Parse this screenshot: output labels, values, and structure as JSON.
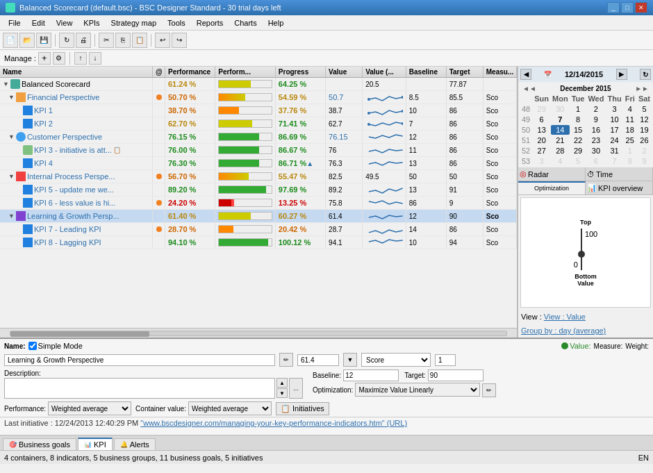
{
  "titleBar": {
    "title": "Balanced Scorecard (default.bsc) - BSC Designer Standard - 30 trial days left",
    "icon": "bsc-icon"
  },
  "menuBar": {
    "items": [
      "File",
      "Edit",
      "View",
      "KPIs",
      "Strategy map",
      "Tools",
      "Reports",
      "Charts",
      "Help"
    ]
  },
  "manageBar": {
    "label": "Manage :"
  },
  "tableHeaders": {
    "name": "Name",
    "at": "@",
    "performance": "Performance",
    "performBar": "Perform...",
    "progress": "Progress",
    "value": "Value",
    "value2": "Value (...",
    "baseline": "Baseline",
    "target": "Target",
    "measure": "Measu..."
  },
  "tableRows": [
    {
      "indent": 0,
      "type": "root",
      "name": "Balanced Scorecard",
      "perf": "",
      "prog": "64.25 %",
      "value": "",
      "value2": "20.5",
      "baseline": "",
      "target": "77.87",
      "measure": "",
      "expanded": true,
      "perfVal": "61.24 %",
      "perfColor": "yellow"
    },
    {
      "indent": 1,
      "type": "perspective",
      "name": "Financial Perspective",
      "perf": "50.70 %",
      "perfColor": "orange",
      "prog": "54.59 %",
      "value": "50.7",
      "value2": "",
      "baseline": "8.5",
      "target": "85.5",
      "measure": "Sco",
      "expanded": true
    },
    {
      "indent": 2,
      "type": "kpi",
      "name": "KPI 1",
      "perf": "38.70 %",
      "perfColor": "orange",
      "prog": "37.76 %",
      "value": "38.7",
      "value2": "",
      "baseline": "10",
      "target": "86",
      "measure": "Sco"
    },
    {
      "indent": 2,
      "type": "kpi",
      "name": "KPI 2",
      "perf": "62.70 %",
      "perfColor": "yellow",
      "prog": "71.41 %",
      "value": "62.7",
      "value2": "",
      "baseline": "7",
      "target": "86",
      "measure": "Sco"
    },
    {
      "indent": 1,
      "type": "perspective",
      "name": "Customer Perspective",
      "perf": "76.15 %",
      "perfColor": "green",
      "prog": "86.69 %",
      "value": "76.15",
      "value2": "",
      "baseline": "12",
      "target": "86",
      "measure": "Sco",
      "expanded": true
    },
    {
      "indent": 2,
      "type": "initiative",
      "name": "KPI 3 - initiative is att...",
      "perf": "76.00 %",
      "perfColor": "green",
      "prog": "86.67 %",
      "value": "76",
      "value2": "",
      "baseline": "11",
      "target": "86",
      "measure": "Sco"
    },
    {
      "indent": 2,
      "type": "kpi",
      "name": "KPI 4",
      "perf": "76.30 %",
      "perfColor": "green",
      "prog": "86.71 %",
      "value": "76.3",
      "value2": "",
      "baseline": "13",
      "target": "86",
      "measure": "Sco"
    },
    {
      "indent": 1,
      "type": "perspective",
      "name": "Internal Process Perspe...",
      "perf": "56.70 %",
      "perfColor": "orange",
      "prog": "55.47 %",
      "value": "82.5",
      "value2": "49.5",
      "baseline": "50",
      "target": "50",
      "measure": "Sco",
      "expanded": true
    },
    {
      "indent": 2,
      "type": "kpi",
      "name": "KPI 5 - update me we...",
      "perf": "89.20 %",
      "perfColor": "green",
      "prog": "97.69 %",
      "value": "89.2",
      "value2": "",
      "baseline": "13",
      "target": "91",
      "measure": "Sco"
    },
    {
      "indent": 2,
      "type": "kpi",
      "name": "KPI 6 - less value is hi...",
      "perf": "24.20 %",
      "perfColor": "red",
      "prog": "13.25 %",
      "value": "75.8",
      "value2": "",
      "baseline": "86",
      "target": "9",
      "measure": "Sco"
    },
    {
      "indent": 1,
      "type": "perspective",
      "name": "Learning & Growth Persp...",
      "perf": "61.40 %",
      "perfColor": "yellow",
      "prog": "60.27 %",
      "value": "61.4",
      "value2": "",
      "baseline": "12",
      "target": "90",
      "measure": "Sco",
      "selected": true,
      "expanded": true
    },
    {
      "indent": 2,
      "type": "kpi",
      "name": "KPI 7 - Leading KPI",
      "perf": "28.70 %",
      "perfColor": "orange",
      "prog": "20.42 %",
      "value": "28.7",
      "value2": "",
      "baseline": "14",
      "target": "86",
      "measure": "Sco"
    },
    {
      "indent": 2,
      "type": "kpi",
      "name": "KPI 8 - Lagging KPI",
      "perf": "94.10 %",
      "perfColor": "green",
      "prog": "100.12 %",
      "value": "94.1",
      "value2": "",
      "baseline": "10",
      "target": "94",
      "measure": "Sco"
    }
  ],
  "rightPanel": {
    "dateHeader": "12/14/2015",
    "calMonth": "December 2015",
    "calDays": [
      "Sun",
      "Mon",
      "Tue",
      "Wed",
      "Thu",
      "Fri",
      "Sat"
    ],
    "calWeeks": [
      {
        "week": 48,
        "days": [
          "29",
          "30",
          "1",
          "2",
          "3",
          "4",
          "5"
        ]
      },
      {
        "week": 49,
        "days": [
          "6",
          "7",
          "8",
          "9",
          "10",
          "11",
          "12"
        ]
      },
      {
        "week": 50,
        "days": [
          "13",
          "14",
          "15",
          "16",
          "17",
          "18",
          "19"
        ]
      },
      {
        "week": 51,
        "days": [
          "20",
          "21",
          "22",
          "23",
          "24",
          "25",
          "26"
        ]
      },
      {
        "week": 52,
        "days": [
          "27",
          "28",
          "29",
          "30",
          "31",
          "1",
          "2"
        ]
      },
      {
        "week": 53,
        "days": [
          "3",
          "4",
          "5",
          "6",
          "7",
          "8",
          "9"
        ]
      }
    ],
    "tabs": [
      "Radar",
      "Time",
      "Optimization",
      "KPI overview"
    ],
    "topLabel": "Top",
    "bottomLabel": "Bottom",
    "valueLabel": "Value",
    "viewLabel": "View : Value",
    "groupByLabel": "Group by : day (average)"
  },
  "bottomPanel": {
    "nameLabel": "Name:",
    "simpleModeLabel": "Simple Mode",
    "valueLabel": "Value:",
    "measureLabel": "Measure:",
    "weightLabel": "Weight:",
    "nameValue": "Learning & Growth Perspective",
    "valueValue": "61.4",
    "measureValue": "Score",
    "weightValue": "1",
    "descriptionLabel": "Description:",
    "baselineLabel": "Baseline:",
    "targetLabel": "Target:",
    "baselineValue": "12",
    "targetValue": "90",
    "performanceLabel": "Performance:",
    "containerLabel": "Container value:",
    "optimizationLabel": "Optimization:",
    "performanceValue": "Weighted average",
    "containerValue": "Weighted average",
    "optimizationValue": "Maximize Value Linearly",
    "initiativesLabel": "Initiatives",
    "lastInitiative": "Last initiative : 12/24/2013 12:40:29 PM  \"www.bscdesigner.com/managing-your-key-performance-indicators.htm\" (URL)"
  },
  "statusTabs": [
    {
      "label": "Business goals",
      "icon": "goals-icon",
      "active": false
    },
    {
      "label": "KPI",
      "icon": "kpi-icon",
      "active": true
    },
    {
      "label": "Alerts",
      "icon": "alerts-icon",
      "active": false
    }
  ],
  "statusBar": {
    "text": "4 containers, 8 indicators, 5 business groups, 11 business goals, 5 initiatives",
    "locale": "EN"
  }
}
